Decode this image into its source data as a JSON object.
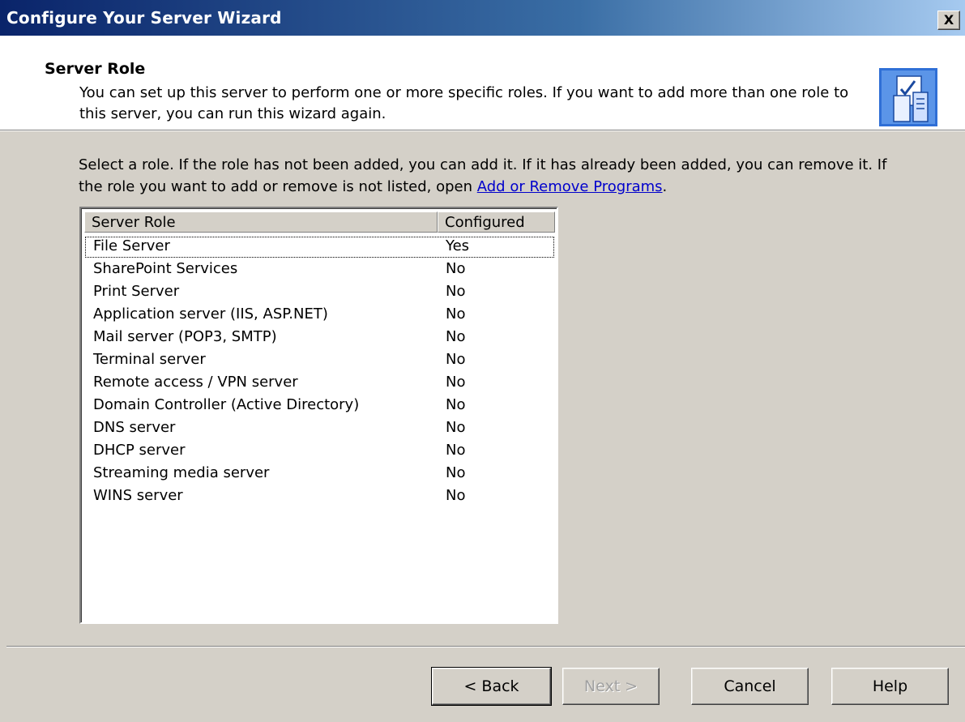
{
  "window": {
    "title": "Configure Your Server Wizard",
    "close_label": "X"
  },
  "header": {
    "heading": "Server Role",
    "description": "You can set up this server to perform one or more specific roles. If you want to add more than one role to this server, you can run this wizard again."
  },
  "instruction": {
    "text": "Select a role. If the role has not been added, you can add it. If it has already been added, you can remove it. If the role you want to add or remove is not listed, open ",
    "link": "Add or Remove Programs",
    "suffix": "."
  },
  "listview": {
    "columns": [
      "Server Role",
      "Configured"
    ],
    "rows": [
      {
        "role": "File Server",
        "configured": "Yes"
      },
      {
        "role": "SharePoint Services",
        "configured": "No"
      },
      {
        "role": "Print Server",
        "configured": "No"
      },
      {
        "role": "Application server (IIS, ASP.NET)",
        "configured": "No"
      },
      {
        "role": "Mail server (POP3, SMTP)",
        "configured": "No"
      },
      {
        "role": "Terminal server",
        "configured": "No"
      },
      {
        "role": "Remote access / VPN server",
        "configured": "No"
      },
      {
        "role": "Domain Controller (Active Directory)",
        "configured": "No"
      },
      {
        "role": "DNS server",
        "configured": "No"
      },
      {
        "role": "DHCP server",
        "configured": "No"
      },
      {
        "role": "Streaming media server",
        "configured": "No"
      },
      {
        "role": "WINS server",
        "configured": "No"
      }
    ]
  },
  "buttons": {
    "back": "< Back",
    "next": "Next >",
    "cancel": "Cancel",
    "help": "Help"
  },
  "icons": {
    "header_icon": "server-wizard-icon"
  },
  "colors": {
    "titlebar_start": "#0a246a",
    "titlebar_end": "#a6caf0",
    "link": "#0000cc",
    "window_bg": "#d4d0c8"
  }
}
